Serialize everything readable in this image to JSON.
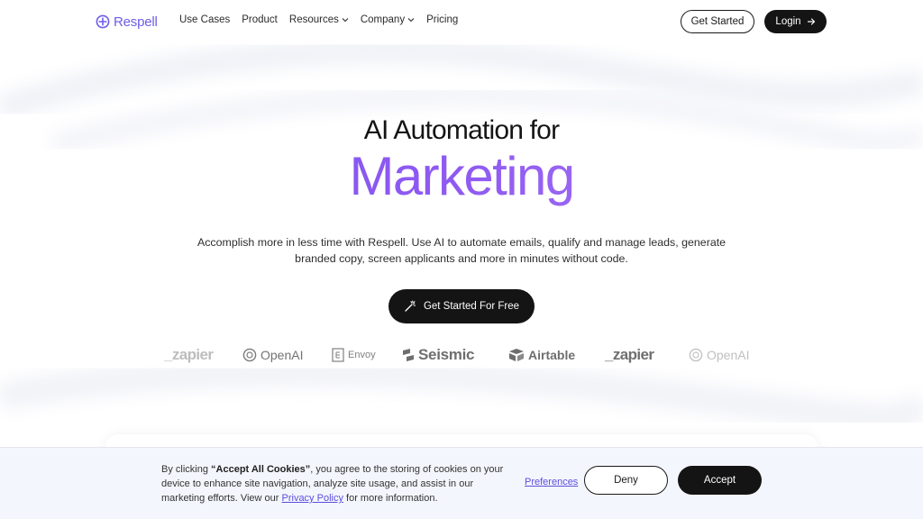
{
  "brand": {
    "name": "Respell",
    "accent": "#6d5ce8"
  },
  "nav": {
    "items": [
      {
        "label": "Use Cases",
        "dropdown": false
      },
      {
        "label": "Product",
        "dropdown": false
      },
      {
        "label": "Resources",
        "dropdown": true
      },
      {
        "label": "Company",
        "dropdown": true
      },
      {
        "label": "Pricing",
        "dropdown": false
      }
    ],
    "get_started": "Get Started",
    "login": "Login"
  },
  "hero": {
    "line1": "AI Automation for",
    "line2": "Marketing",
    "subtitle": "Accomplish more in less time with Respell. Use AI to automate emails, qualify and manage leads, generate branded copy, screen applicants and more in minutes without code.",
    "cta": "Get Started For Free",
    "gradient": [
      "#7b52ee",
      "#b784f4"
    ]
  },
  "logos": [
    "_zapier",
    "OpenAI",
    "Envoy",
    "Seismic",
    "Airtable",
    "_zapier",
    "OpenAI"
  ],
  "cookie": {
    "text_before": "By clicking ",
    "text_bold": "“Accept All Cookies”",
    "text_after": ", you agree to the storing of cookies on your device to enhance site navigation, analyze site usage, and assist in our marketing efforts. View our ",
    "privacy_link": "Privacy Policy",
    "text_end": " for more information.",
    "preferences": "Preferences",
    "deny": "Deny",
    "accept": "Accept"
  }
}
